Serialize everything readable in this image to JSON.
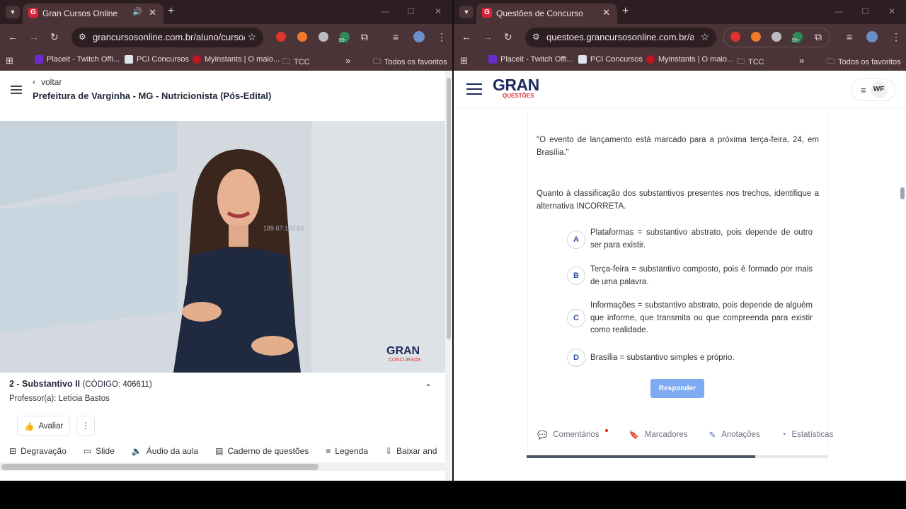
{
  "left": {
    "tab_title": "Gran Cursos Online",
    "url": "grancursosonline.com.br/aluno/curso/...",
    "bookmarks": [
      "Placeit - Twitch Offi...",
      "PCI Concursos",
      "Myinstants | O maio...",
      "TCC"
    ],
    "all_bookmarks": "Todos os favoritos",
    "back_label": "voltar",
    "course_title": "Prefeitura de Varginha - MG - Nutricionista (Pós-Edital)",
    "video_watermark": "GRAN",
    "video_watermark_sub": "CONCURSOS",
    "video_overlay_text": "189.6?.158.84",
    "lesson_title": "2 - Substantivo II",
    "lesson_code": "(CÓDIGO: 406611)",
    "teacher": "Professor(a): Letícia Bastos",
    "rate_label": "Avaliar",
    "tools": [
      "Degravação",
      "Slide",
      "Áudio da aula",
      "Caderno de questões",
      "Legenda",
      "Baixar and"
    ]
  },
  "right": {
    "tab_title": "Questões de Concurso",
    "url": "questoes.grancursosonline.com.br/alu...",
    "bookmarks": [
      "Placeit - Twitch Offi...",
      "PCI Concursos",
      "Myinstants | O maio...",
      "TCC"
    ],
    "all_bookmarks": "Todos os favoritos",
    "logo": "GRAN",
    "logo_sub": "QUESTÕES",
    "user_initials": "WF",
    "quote": "\"O evento de lançamento está marcado para a próxima terça-feira, 24, em Brasília.\"",
    "prompt": "Quanto à classificação dos substantivos presentes nos trechos, identifique a alternativa INCORRETA.",
    "options": [
      {
        "letter": "A",
        "text": "Plataformas = substantivo abstrato, pois depende de outro ser para existir."
      },
      {
        "letter": "B",
        "text": "Terça-feira = substantivo composto, pois é formado por mais de uma palavra."
      },
      {
        "letter": "C",
        "text": "Informações = substantivo abstrato, pois depende de alguém que informe, que transmita ou que compreenda para existir como realidade."
      },
      {
        "letter": "D",
        "text": "Brasília = substantivo simples e próprio."
      }
    ],
    "respond_label": "Responder",
    "tabs": [
      "Comentários",
      "Marcadores",
      "Anotações",
      "Estatísticas"
    ],
    "progress_fraction": 0.76
  },
  "ext_badge": "99+",
  "colors": {
    "brand_navy": "#1d2a5c",
    "brand_red": "#e0322f",
    "accent_blue": "#7daaf0"
  }
}
